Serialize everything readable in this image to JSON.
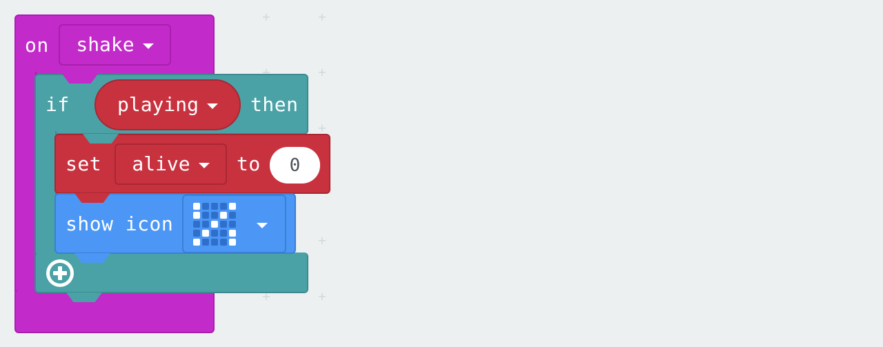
{
  "event_block": {
    "label": "on",
    "dropdown": "shake"
  },
  "if_block": {
    "if_label": "if",
    "condition_var": "playing",
    "then_label": "then"
  },
  "set_block": {
    "label": "set",
    "variable": "alive",
    "to_label": "to",
    "value": "0"
  },
  "show_icon_block": {
    "label": "show icon",
    "icon_pattern": [
      [
        1,
        0,
        0,
        0,
        1
      ],
      [
        1,
        0,
        0,
        1,
        0
      ],
      [
        0,
        0,
        1,
        0,
        0
      ],
      [
        0,
        1,
        0,
        0,
        1
      ],
      [
        1,
        0,
        0,
        0,
        1
      ]
    ]
  },
  "colors": {
    "workspace": "#ecf0f1",
    "event": "#c22ac9",
    "logic": "#4aa2a6",
    "variables": "#c8323f",
    "basic": "#4c97f5"
  }
}
